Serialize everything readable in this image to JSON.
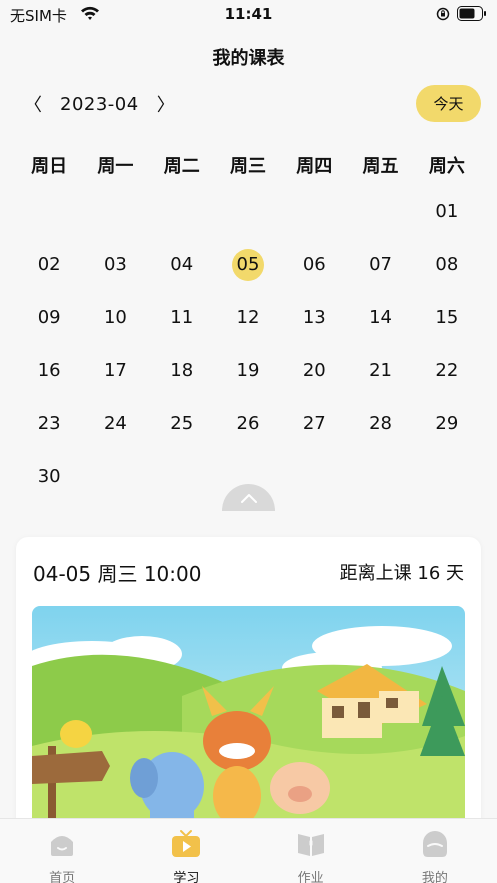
{
  "status_bar": {
    "carrier": "无SIM卡",
    "time": "11:41"
  },
  "header": {
    "title": "我的课表"
  },
  "calendar": {
    "month": "2023-04",
    "prev_symbol": "〈",
    "next_symbol": "〉",
    "today_label": "今天",
    "weekdays": [
      "周日",
      "周一",
      "周二",
      "周三",
      "周四",
      "周五",
      "周六"
    ],
    "days": [
      "01",
      "02",
      "03",
      "04",
      "05",
      "06",
      "07",
      "08",
      "09",
      "10",
      "11",
      "12",
      "13",
      "14",
      "15",
      "16",
      "17",
      "18",
      "19",
      "20",
      "21",
      "22",
      "23",
      "24",
      "25",
      "26",
      "27",
      "28",
      "29",
      "30"
    ],
    "selected_day": "05"
  },
  "course": {
    "time": "04-05 周三 10:00",
    "countdown": "距离上课 16 天"
  },
  "tabs": [
    {
      "label": "首页",
      "icon": "home-icon",
      "active": false
    },
    {
      "label": "学习",
      "icon": "play-tv-icon",
      "active": true
    },
    {
      "label": "作业",
      "icon": "book-icon",
      "active": false
    },
    {
      "label": "我的",
      "icon": "profile-icon",
      "active": false
    }
  ],
  "colors": {
    "accent": "#f2d96b",
    "inactive_tab": "#cccccc",
    "background": "#f7f7f7"
  }
}
